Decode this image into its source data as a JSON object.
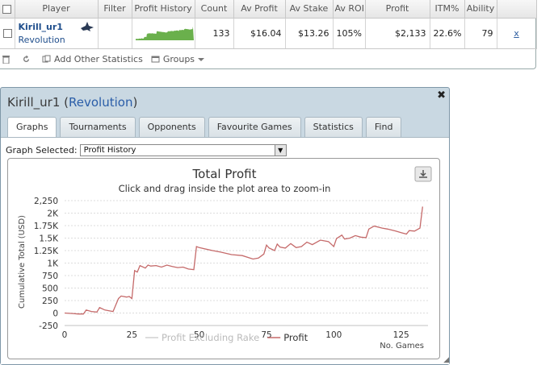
{
  "table": {
    "headers": [
      "Player",
      "Filter",
      "Profit History",
      "Count",
      "Av Profit",
      "Av Stake",
      "Av ROI",
      "Profit",
      "ITM%",
      "Ability"
    ],
    "row": {
      "player": "Kirill_ur1",
      "site": "Revolution",
      "count": "133",
      "av_profit": "$16.04",
      "av_stake": "$13.26",
      "av_roi": "105%",
      "profit": "$2,133",
      "itm": "22.6%",
      "ability": "79",
      "remove": "x"
    }
  },
  "toolbar": {
    "add_stats": "Add Other Statistics",
    "groups": "Groups"
  },
  "window": {
    "player": "Kirill_ur1",
    "site": "Revolution",
    "tabs": [
      "Graphs",
      "Tournaments",
      "Opponents",
      "Favourite Games",
      "Statistics",
      "Find"
    ],
    "graph_label": "Graph Selected:",
    "graph_value": "Profit History"
  },
  "colors": {
    "profit_line": "#c56a6a",
    "excl_rake_line": "#d0d0d0",
    "mini_chart_fill": "#6ab04c",
    "accent_link": "#2a5da8"
  },
  "chart_data": {
    "type": "line",
    "title": "Total Profit",
    "subtitle": "Click and drag inside the plot area to zoom-in",
    "xlabel": "No. Games",
    "ylabel": "Cumulative Total (USD)",
    "xlim": [
      0,
      135
    ],
    "ylim": [
      -250,
      2250
    ],
    "x_ticks": [
      0,
      25,
      50,
      75,
      100,
      125
    ],
    "y_ticks": [
      -250,
      0,
      250,
      500,
      750,
      1000,
      1250,
      1500,
      1750,
      2000,
      2250
    ],
    "y_tick_labels": [
      "-250",
      "0",
      "250",
      "500",
      "750",
      "1K",
      "1.25K",
      "1.5K",
      "1.75K",
      "2K",
      "2,250"
    ],
    "grid": true,
    "legend_position": "bottom",
    "series": [
      {
        "name": "Profit Excluding Rake",
        "visible": false,
        "x": [],
        "y": []
      },
      {
        "name": "Profit",
        "visible": true,
        "x": [
          0,
          3,
          5,
          7,
          8,
          10,
          12,
          13,
          15,
          18,
          20,
          21,
          23,
          24,
          25,
          26,
          27,
          28,
          30,
          31,
          32,
          34,
          36,
          38,
          40,
          42,
          44,
          46,
          48,
          49,
          50,
          55,
          58,
          62,
          66,
          70,
          72,
          74,
          75,
          76,
          78,
          79,
          80,
          82,
          84,
          86,
          88,
          90,
          92,
          95,
          98,
          100,
          101,
          103,
          104,
          106,
          108,
          110,
          112,
          113,
          115,
          118,
          120,
          123,
          125,
          127,
          128,
          130,
          132,
          133
        ],
        "y": [
          0,
          -10,
          -20,
          -20,
          60,
          30,
          20,
          110,
          60,
          30,
          290,
          340,
          320,
          330,
          290,
          850,
          820,
          950,
          900,
          960,
          940,
          950,
          920,
          960,
          930,
          910,
          920,
          880,
          870,
          1330,
          1310,
          1250,
          1220,
          1170,
          1150,
          1080,
          1100,
          1180,
          1360,
          1300,
          1250,
          1380,
          1320,
          1300,
          1390,
          1310,
          1330,
          1420,
          1370,
          1460,
          1430,
          1330,
          1490,
          1560,
          1480,
          1500,
          1550,
          1520,
          1510,
          1680,
          1740,
          1700,
          1680,
          1640,
          1610,
          1580,
          1650,
          1640,
          1700,
          2130
        ]
      }
    ]
  }
}
